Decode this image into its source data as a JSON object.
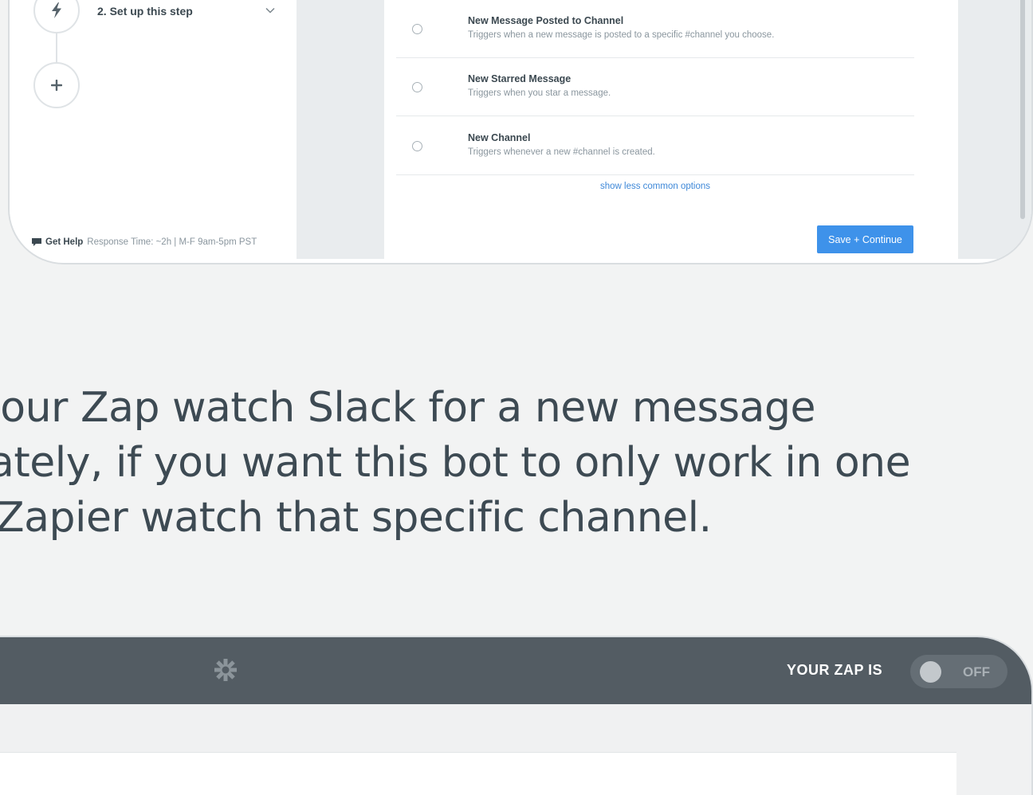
{
  "sidebar": {
    "step_label": "2. Set up this step",
    "get_help": {
      "label": "Get Help",
      "info": "Response Time: ~2h | M-F 9am-5pm PST"
    }
  },
  "options": [
    {
      "title": "New Message Posted to Channel",
      "description": "Triggers when a new message is posted to a specific #channel you choose."
    },
    {
      "title": "New Starred Message",
      "description": "Triggers when you star a message."
    },
    {
      "title": "New Channel",
      "description": "Triggers whenever a new #channel is created."
    }
  ],
  "show_less_label": "show less common options",
  "save_button_label": "Save + Continue",
  "caption": {
    "line1": "your Zap watch Slack for a new message",
    "line2": "ately, if you want this bot to only work in one",
    "line3": "Zapier watch that specific channel."
  },
  "status_bar": {
    "zap_label": "YOUR ZAP IS",
    "toggle_state": "OFF"
  },
  "icons": {
    "step_one": "lightning-icon",
    "step_two": "plus-icon",
    "expand": "chevron-down-icon",
    "help": "chat-bubble-icon",
    "logo": "zapier-asterisk-icon"
  },
  "colors": {
    "accent_blue": "#3e92ea",
    "link_blue": "#3e88d8",
    "topbar": "#535c63"
  }
}
